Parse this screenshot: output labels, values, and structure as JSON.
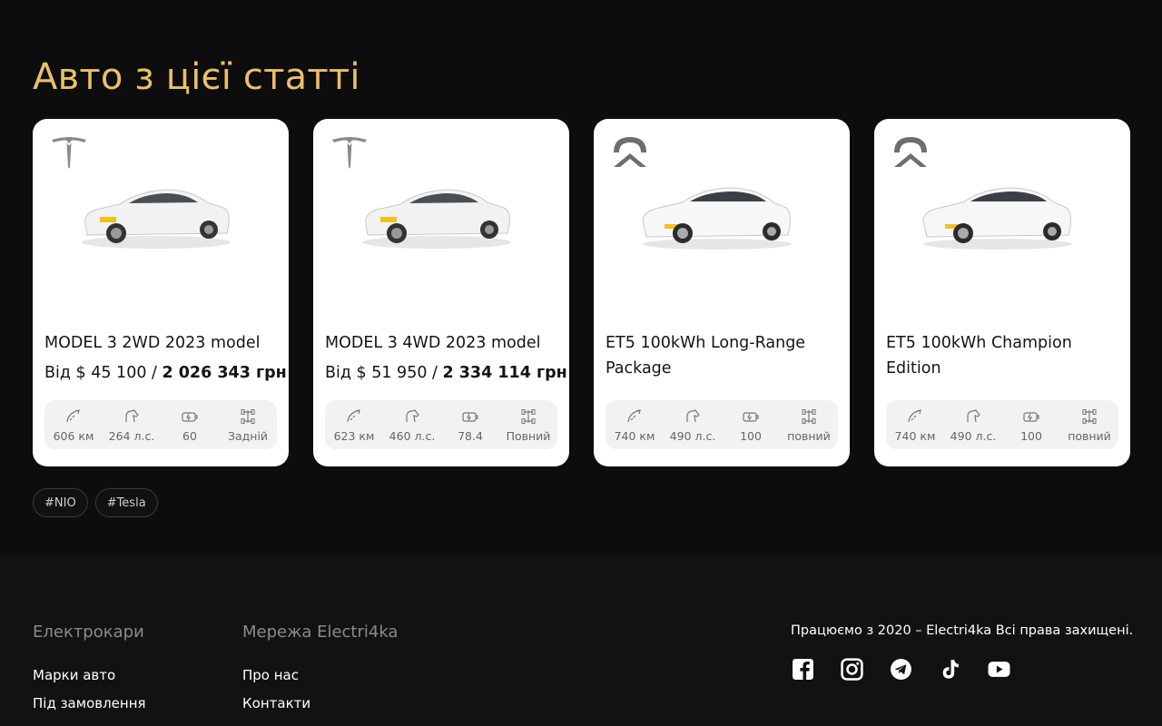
{
  "section": {
    "title": "Авто з цієї статті"
  },
  "cards": [
    {
      "brand": "tesla-logo-icon",
      "name": "MODEL 3 2WD 2023 model",
      "price_prefix": "Від $ 45 100 / ",
      "price_uah": "2 026 343 грн",
      "specs": [
        "606 км",
        "264 л.с.",
        "60",
        "Задній"
      ]
    },
    {
      "brand": "tesla-logo-icon",
      "name": "MODEL 3 4WD 2023 model",
      "price_prefix": "Від $ 51 950 / ",
      "price_uah": "2 334 114 грн",
      "specs": [
        "623 км",
        "460 л.с.",
        "78.4",
        "Повний"
      ]
    },
    {
      "brand": "nio-logo-icon",
      "name": "ET5 100kWh Long-Range Package",
      "price_prefix": "",
      "price_uah": "",
      "specs": [
        "740 км",
        "490 л.с.",
        "100",
        "повний"
      ]
    },
    {
      "brand": "nio-logo-icon",
      "name": "ET5 100kWh Champion Edition",
      "price_prefix": "",
      "price_uah": "",
      "specs": [
        "740 км",
        "490 л.с.",
        "100",
        "повний"
      ]
    }
  ],
  "tags": [
    "#NIO",
    "#Tesla"
  ],
  "footer": {
    "col1": {
      "heading": "Електрокари",
      "links": [
        "Марки авто",
        "Під замовлення"
      ]
    },
    "col2": {
      "heading": "Мережа Electri4ka",
      "links": [
        "Про нас",
        "Контакти"
      ]
    },
    "copyright": "Працюємо з 2020 – Electri4ka Всі права захищені.",
    "social": [
      "facebook-icon",
      "instagram-icon",
      "telegram-icon",
      "tiktok-icon",
      "youtube-icon"
    ]
  },
  "colors": {
    "accent": "#e8c06a",
    "background": "#0d0d0d",
    "card": "#ffffff"
  }
}
